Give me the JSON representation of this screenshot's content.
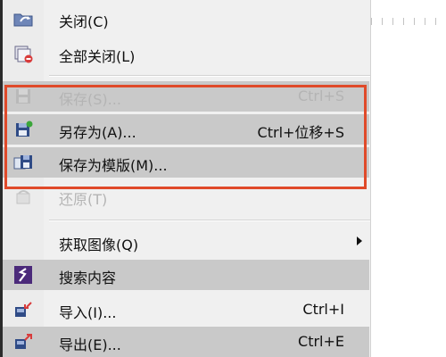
{
  "menu": {
    "items": [
      {
        "id": "close",
        "label": "关闭(C)",
        "shortcut": "",
        "icon": "folder-arrow-icon"
      },
      {
        "id": "close-all",
        "label": "全部关闭(L)",
        "shortcut": "",
        "icon": "close-all-icon"
      },
      {
        "id": "save",
        "label": "保存(S)...",
        "shortcut": "Ctrl+S",
        "icon": "save-icon",
        "disabled": true
      },
      {
        "id": "save-as",
        "label": "另存为(A)...",
        "shortcut": "Ctrl+位移+S",
        "icon": "save-as-icon"
      },
      {
        "id": "save-template",
        "label": "保存为模版(M)...",
        "shortcut": "",
        "icon": "save-template-icon"
      },
      {
        "id": "revert",
        "label": "还原(T)",
        "shortcut": "",
        "icon": "revert-icon",
        "disabled": true
      },
      {
        "id": "acquire",
        "label": "获取图像(Q)",
        "shortcut": "",
        "icon": "",
        "submenu": true
      },
      {
        "id": "search-content",
        "label": "搜索内容",
        "shortcut": "",
        "icon": "search-content-icon"
      },
      {
        "id": "import",
        "label": "导入(I)...",
        "shortcut": "Ctrl+I",
        "icon": "import-icon"
      },
      {
        "id": "export",
        "label": "导出(E)...",
        "shortcut": "Ctrl+E",
        "icon": "export-icon"
      }
    ]
  },
  "colors": {
    "highlight": "#c9c9c9",
    "annotation_box": "#e04a2a",
    "disabled_text": "#b4b4b4"
  }
}
